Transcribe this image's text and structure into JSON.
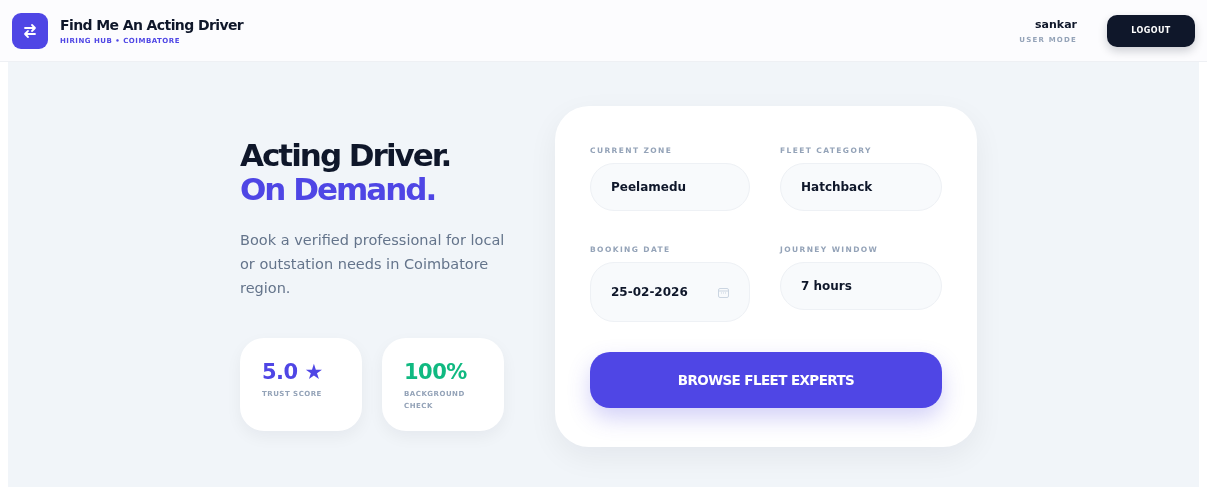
{
  "header": {
    "title": "Find Me An Acting Driver",
    "subtitle": "HIRING HUB • COIMBATORE",
    "user": "sankar",
    "mode": "USER MODE",
    "logout": "LOGOUT"
  },
  "hero": {
    "headline": "Acting Driver.",
    "accent": "On Demand.",
    "description": "Book a verified professional for local or outstation needs in Coimbatore region."
  },
  "stats": [
    {
      "value": "5.0",
      "star": "★",
      "label": "TRUST SCORE",
      "color": "#4f46e5"
    },
    {
      "value": "100%",
      "label": "BACKGROUND CHECK",
      "color": "#10b981"
    }
  ],
  "form": {
    "fields": [
      {
        "label": "CURRENT ZONE",
        "value": "Peelamedu",
        "kind": "text"
      },
      {
        "label": "FLEET CATEGORY",
        "value": "Hatchback",
        "kind": "text"
      },
      {
        "label": "BOOKING DATE",
        "value": "25-02-2026",
        "kind": "date"
      },
      {
        "label": "JOURNEY WINDOW",
        "value": "7 hours",
        "kind": "text"
      }
    ],
    "button": "BROWSE FLEET EXPERTS"
  }
}
